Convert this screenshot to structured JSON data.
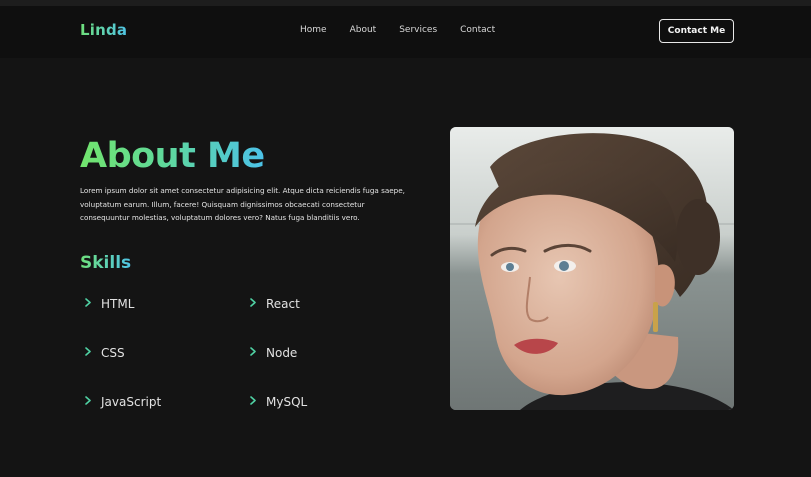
{
  "nav": {
    "logo": "Linda",
    "links": [
      "Home",
      "About",
      "Services",
      "Contact"
    ],
    "cta_label": "Contact Me"
  },
  "about": {
    "title": "About Me",
    "description": "Lorem ipsum dolor sit amet consectetur adipisicing elit. Atque dicta reiciendis fuga saepe, voluptatum earum. Illum, facere! Quisquam dignissimos obcaecati consectetur consequuntur molestias, voluptatum dolores vero? Natus fuga blanditiis vero."
  },
  "skills": {
    "title": "Skills",
    "items": [
      "HTML",
      "React",
      "CSS",
      "Node",
      "JavaScript",
      "MySQL"
    ],
    "icon": "chevron-right-icon"
  },
  "photo": {
    "subject": "portrait-photo"
  },
  "colors": {
    "background": "#141414",
    "navbar": "#0f0f0f",
    "gradient_start": "#6fe07a",
    "gradient_end": "#4fc4e6",
    "chevron": "#4fd1a3"
  }
}
